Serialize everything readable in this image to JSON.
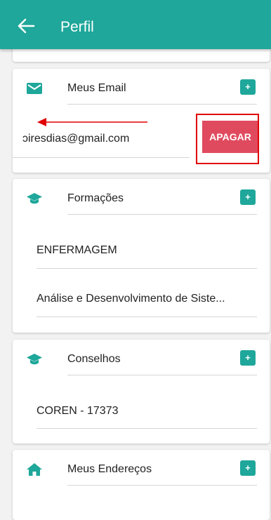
{
  "appbar": {
    "title": "Perfil",
    "back_icon": "arrow-left-icon",
    "color": "#1ea79a"
  },
  "sections": {
    "emails": {
      "title": "Meus Email",
      "icon": "envelope-icon",
      "add_label": "+",
      "items": [
        "piresdias@gmail.com"
      ],
      "visible_text": "ɔiresdias@gmail.com",
      "delete_label": "APAGAR",
      "delete_color": "#e04a5e"
    },
    "formacoes": {
      "title": "Formações",
      "icon": "graduation-cap-icon",
      "add_label": "+",
      "items": [
        "ENFERMAGEM",
        "Análise e Desenvolvimento de Siste..."
      ]
    },
    "conselhos": {
      "title": "Conselhos",
      "icon": "graduation-cap-icon",
      "add_label": "+",
      "items": [
        "COREN - 17373"
      ]
    },
    "enderecos": {
      "title": "Meus Endereços",
      "icon": "home-icon",
      "add_label": "+"
    }
  },
  "annotation": {
    "arrow_color": "#e00000",
    "highlight_color": "#e00000"
  }
}
